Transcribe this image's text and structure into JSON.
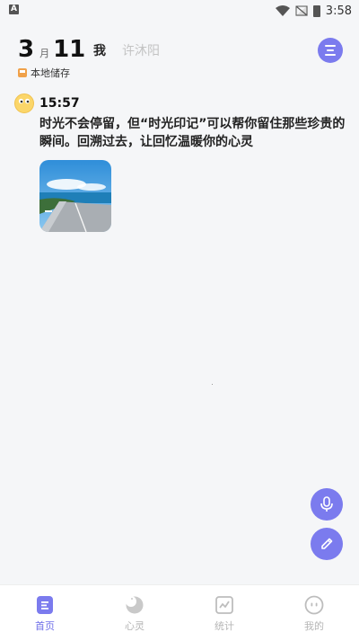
{
  "statusbar": {
    "app_badge": "A",
    "time": "3:58"
  },
  "header": {
    "month": "3",
    "month_unit": "月",
    "day": "11",
    "tab_me": "我",
    "tab_other": "许沐阳",
    "storage_label": "本地储存"
  },
  "entry": {
    "time": "15:57",
    "text": "时光不会停留，但“时光印记”可以帮你留住那些珍贵的瞬间。回溯过去，让回忆温暖你的心灵"
  },
  "nav": {
    "items": [
      {
        "label": "首页",
        "icon": "home-icon"
      },
      {
        "label": "心灵",
        "icon": "moon-icon"
      },
      {
        "label": "统计",
        "icon": "chart-icon"
      },
      {
        "label": "我的",
        "icon": "profile-icon"
      }
    ]
  },
  "colors": {
    "accent": "#7b7bee",
    "active_nav": "#6f6fe8",
    "inactive": "#b5b5b5"
  }
}
